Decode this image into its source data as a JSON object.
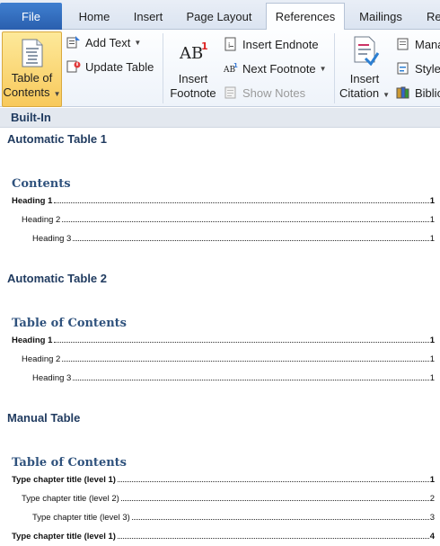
{
  "tabs": {
    "file": "File",
    "home": "Home",
    "insert": "Insert",
    "page_layout": "Page Layout",
    "references": "References",
    "mailings": "Mailings",
    "review_partial": "Re"
  },
  "ribbon": {
    "toc_line1": "Table of",
    "toc_line2": "Contents",
    "add_text": "Add Text",
    "update_table": "Update Table",
    "insert_footnote_line1": "Insert",
    "insert_footnote_line2": "Footnote",
    "insert_endnote": "Insert Endnote",
    "next_footnote": "Next Footnote",
    "show_notes": "Show Notes",
    "insert_citation_line1": "Insert",
    "insert_citation_line2": "Citation",
    "manage_partial": "Mana",
    "style_partial": "Style",
    "bibliography_partial": "Biblio"
  },
  "gallery": {
    "section_header": "Built-In",
    "auto1": {
      "title": "Automatic Table 1",
      "heading": "Contents",
      "lines": [
        {
          "text": "Heading 1",
          "page": "1"
        },
        {
          "text": "Heading 2",
          "page": "1"
        },
        {
          "text": "Heading 3",
          "page": "1"
        }
      ]
    },
    "auto2": {
      "title": "Automatic Table 2",
      "heading": "Table of Contents",
      "lines": [
        {
          "text": "Heading 1",
          "page": "1"
        },
        {
          "text": "Heading 2",
          "page": "1"
        },
        {
          "text": "Heading 3",
          "page": "1"
        }
      ]
    },
    "manual": {
      "title": "Manual Table",
      "heading": "Table of Contents",
      "lines": [
        {
          "text": "Type chapter title (level 1)",
          "page": "1"
        },
        {
          "text": "Type chapter title (level 2)",
          "page": "2"
        },
        {
          "text": "Type chapter title (level 3)",
          "page": "3"
        },
        {
          "text": "Type chapter title (level 1)",
          "page": "4"
        }
      ]
    }
  },
  "colors": {
    "file_tab": "#2a5fae",
    "toc_button_highlight": "#f8c95b",
    "heading_blue": "#2f527d"
  }
}
